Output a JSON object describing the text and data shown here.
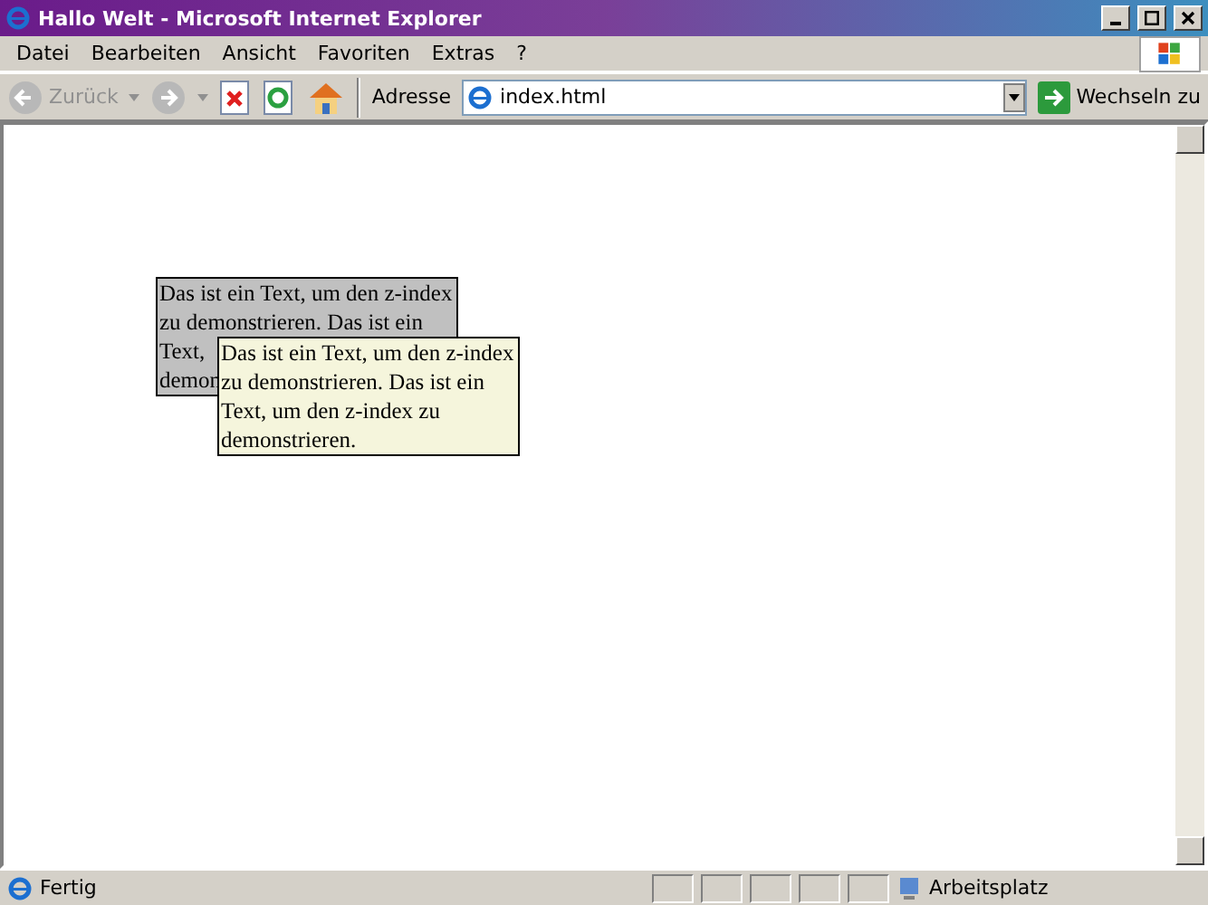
{
  "window": {
    "title": "Hallo Welt - Microsoft Internet Explorer"
  },
  "menu": [
    "Datei",
    "Bearbeiten",
    "Ansicht",
    "Favoriten",
    "Extras",
    "?"
  ],
  "toolbar": {
    "back_label": "Zurück",
    "address_label": "Adresse",
    "address": "index.html",
    "go_label": "Wechseln zu"
  },
  "boxes": [
    {
      "lines": [
        "Das ist ein Text, um den z-index",
        "zu demonstrieren. Das ist ein",
        "Text,",
        "demon"
      ],
      "color": "#c0c0c0"
    },
    {
      "lines": [
        "Das ist ein Text, um den z-index",
        "zu demonstrieren. Das ist ein",
        "Text, um den z-index zu",
        "demonstrieren."
      ],
      "color": "#f5f5dc"
    }
  ],
  "status_bar": {
    "text": "Fertig",
    "zone": "Arbeitsplatz"
  }
}
